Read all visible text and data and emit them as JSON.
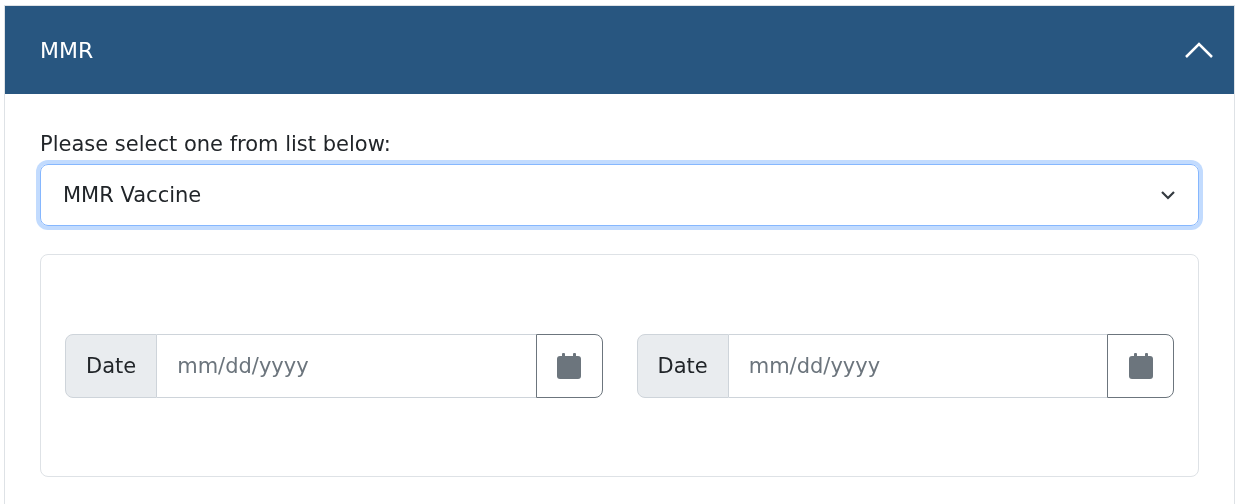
{
  "panel": {
    "title": "MMR",
    "expanded": true
  },
  "select": {
    "label": "Please select one from list below:",
    "value": "MMR Vaccine",
    "focused": true
  },
  "date_fields": [
    {
      "addon": "Date",
      "placeholder": "mm/dd/yyyy"
    },
    {
      "addon": "Date",
      "placeholder": "mm/dd/yyyy"
    }
  ]
}
